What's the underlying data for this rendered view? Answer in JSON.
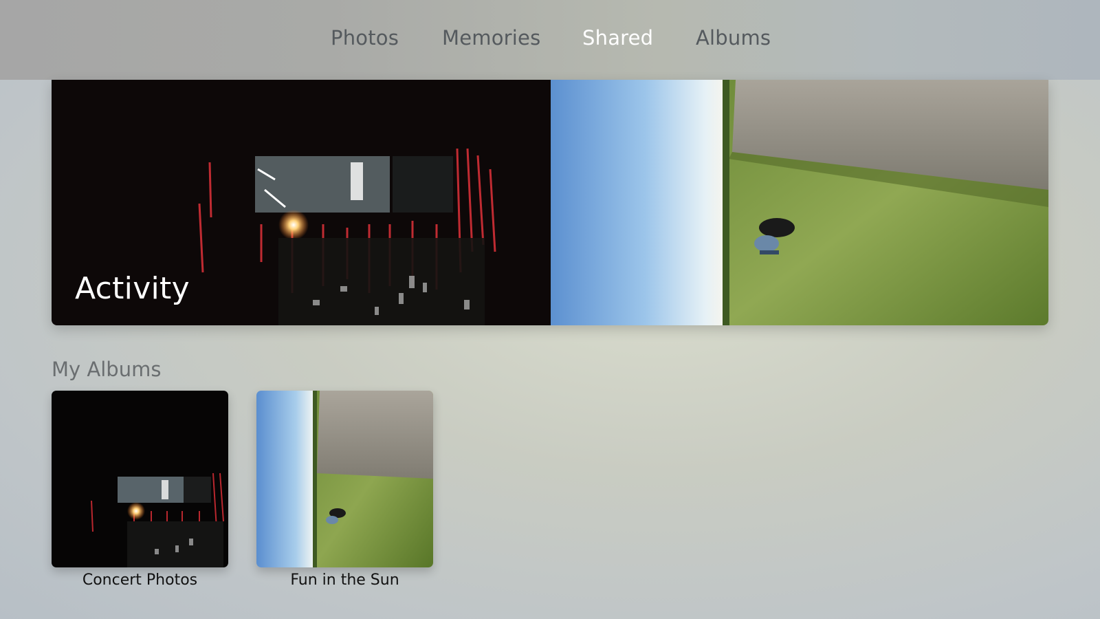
{
  "nav": {
    "tabs": [
      {
        "label": "Photos",
        "active": false
      },
      {
        "label": "Memories",
        "active": false
      },
      {
        "label": "Shared",
        "active": true
      },
      {
        "label": "Albums",
        "active": false
      }
    ]
  },
  "activity": {
    "label": "Activity"
  },
  "my_albums": {
    "title": "My Albums",
    "albums": [
      {
        "title": "Concert Photos"
      },
      {
        "title": "Fun in the Sun"
      }
    ]
  },
  "colors": {
    "active_tab": "#ffffff",
    "inactive_tab": "#555a5e",
    "section_title": "#6a6e70"
  }
}
